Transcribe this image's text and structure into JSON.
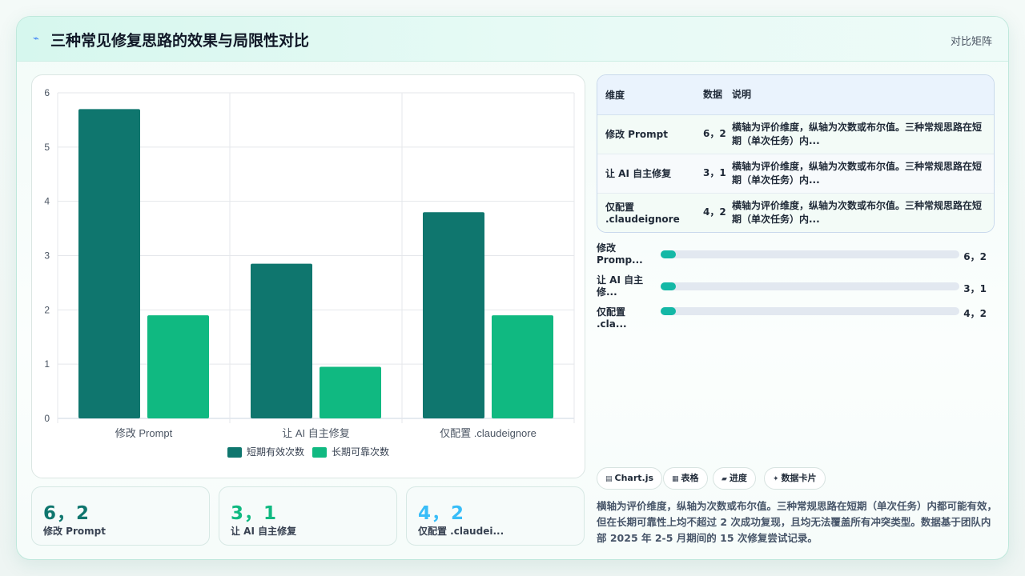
{
  "header": {
    "icon": "pulse-icon",
    "title": "三种常见修复思路的效果与局限性对比",
    "right_label": "对比矩阵"
  },
  "colors": {
    "series_short": "#0f766e",
    "series_long": "#10b981",
    "stat_1": "#0f766e",
    "stat_2": "#10b981",
    "stat_3": "#38bdf8",
    "progress": "#14b8a6"
  },
  "chart_data": {
    "type": "bar",
    "categories": [
      "修改 Prompt",
      "让 AI 自主修复",
      "仅配置 .claudeignore"
    ],
    "series": [
      {
        "name": "短期有效次数",
        "values": [
          5.7,
          2.85,
          3.8
        ]
      },
      {
        "name": "长期可靠次数",
        "values": [
          1.9,
          0.95,
          1.9
        ]
      }
    ],
    "y_ticks": [
      "0",
      "1",
      "2",
      "3",
      "4",
      "5",
      "6"
    ],
    "ylim": [
      0,
      6
    ],
    "grid": true,
    "legend": "bottom"
  },
  "stats": [
    {
      "value": "6，2",
      "label": "修改 Prompt"
    },
    {
      "value": "3，1",
      "label": "让 AI 自主修复"
    },
    {
      "value": "4，2",
      "label": "仅配置 .claudei..."
    }
  ],
  "table": {
    "headers": [
      "维度",
      "数据",
      "说明"
    ],
    "rows": [
      {
        "dim": "修改 Prompt",
        "data": "6，2",
        "desc": "横轴为评价维度，纵轴为次数或布尔值。三种常规思路在短期（单次任务）内..."
      },
      {
        "dim": "让 AI 自主修复",
        "data": "3，1",
        "desc": "横轴为评价维度，纵轴为次数或布尔值。三种常规思路在短期（单次任务）内..."
      },
      {
        "dim": "仅配置 .claudeignore",
        "data": "4，2",
        "desc": "横轴为评价维度，纵轴为次数或布尔值。三种常规思路在短期（单次任务）内..."
      }
    ]
  },
  "progress": [
    {
      "label": "修改 Promp...",
      "value": "6，2",
      "fraction": 0.05
    },
    {
      "label": "让 AI 自主修...",
      "value": "3，1",
      "fraction": 0.05
    },
    {
      "label": "仅配置 .cla...",
      "value": "4，2",
      "fraction": 0.05
    }
  ],
  "chips": [
    {
      "icon": "chart-icon",
      "glyph": "▤",
      "label": "Chart.js"
    },
    {
      "icon": "table-icon",
      "glyph": "▦",
      "label": "表格"
    },
    {
      "icon": "progress-icon",
      "glyph": "▰",
      "label": "进度"
    },
    {
      "icon": "sparkle-icon",
      "glyph": "✦",
      "label": "数据卡片"
    }
  ],
  "note": "横轴为评价维度，纵轴为次数或布尔值。三种常规思路在短期（单次任务）内都可能有效，但在长期可靠性上均不超过 2 次成功复现，且均无法覆盖所有冲突类型。数据基于团队内部 2025 年 2-5 月期间的 15 次修复尝试记录。"
}
